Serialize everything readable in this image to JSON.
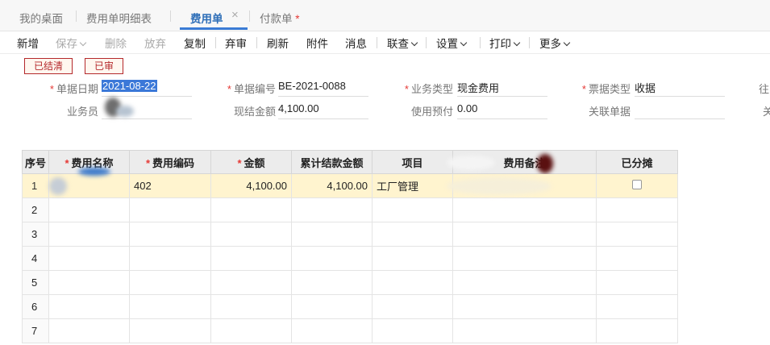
{
  "tabs": [
    {
      "label": "我的桌面"
    },
    {
      "label": "费用单明细表"
    },
    {
      "label": "费用单",
      "active": true
    },
    {
      "label": "付款单",
      "modified": true
    }
  ],
  "tab_close_glyph": "×",
  "modified_mark": "*",
  "toolbar": {
    "new": "新增",
    "save": "保存",
    "delete": "删除",
    "discard": "放弃",
    "copy": "复制",
    "unaudit": "弃审",
    "refresh": "刷新",
    "attach": "附件",
    "message": "消息",
    "linked": "联查",
    "settings": "设置",
    "print": "打印",
    "more": "更多"
  },
  "stamps": {
    "settled": "已结清",
    "audited": "已审"
  },
  "required_mark": "*",
  "form": {
    "date_label": "单据日期",
    "date_value": "2021-08-22",
    "docno_label": "单据编号",
    "docno_value": "BE-2021-0088",
    "biztype_label": "业务类型",
    "biztype_value": "现金费用",
    "billtype_label": "票据类型",
    "billtype_value": "收据",
    "cut_label1": "往",
    "staff_label": "业务员",
    "cash_label": "现结金额",
    "cash_value": "4,100.00",
    "prepay_label": "使用预付",
    "prepay_value": "0.00",
    "related_label": "关联单据",
    "cut_label2": "关"
  },
  "grid": {
    "headers": [
      "序号",
      "费用名称",
      "费用编码",
      "金额",
      "累计结款金额",
      "项目",
      "费用备注",
      "已分摊"
    ],
    "rows": [
      {
        "no": "1",
        "code": "402",
        "amount": "4,100.00",
        "paid": "4,100.00",
        "project": "工厂管理"
      },
      {
        "no": "2"
      },
      {
        "no": "3"
      },
      {
        "no": "4"
      },
      {
        "no": "5"
      },
      {
        "no": "6"
      },
      {
        "no": "7"
      }
    ]
  },
  "colors": {
    "accent": "#3a7bd5",
    "stamp": "#b4282b",
    "highlight_row": "#fff4cf"
  }
}
